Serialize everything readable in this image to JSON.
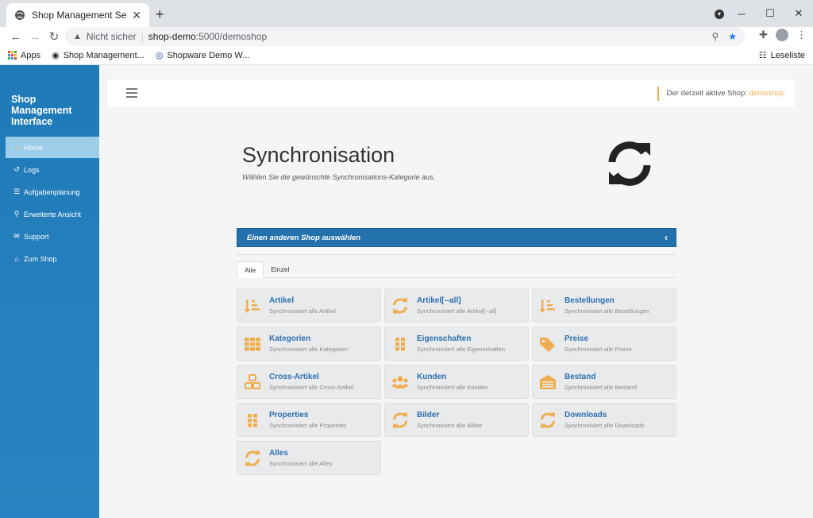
{
  "browser": {
    "tab_title": "Shop Management Service - new",
    "new_tab": "+",
    "window": {
      "minimize": "─",
      "maximize": "☐",
      "close": "✕"
    },
    "address": {
      "security_label": "Nicht sicher",
      "host": "shop-demo",
      "path": ":5000/demoshop"
    },
    "bookmarks": [
      {
        "label": "Apps"
      },
      {
        "label": "Shop Management..."
      },
      {
        "label": "Shopware Demo W..."
      }
    ],
    "reading_list": "Leseliste"
  },
  "sidebar": {
    "brand": [
      "Shop",
      "Management",
      "Interface"
    ],
    "items": [
      {
        "label": "Home",
        "icon": "⌂"
      },
      {
        "label": "Logs",
        "icon": "↺"
      },
      {
        "label": "Aufgabenplanung",
        "icon": "☰"
      },
      {
        "label": "Erweiterte Ansicht",
        "icon": "⚲"
      },
      {
        "label": "Support",
        "icon": "✉"
      },
      {
        "label": "Zum Shop",
        "icon": "⌂"
      }
    ]
  },
  "header": {
    "active_shop_label": "Der derzeit aktive Shop:",
    "active_shop_name": "demoshop"
  },
  "page": {
    "title": "Synchronisation",
    "subtitle": "Wählen Sie die gewünschte Synchronisations-Kategorie aus."
  },
  "shop_panel": {
    "label": "Einen anderen Shop auswählen",
    "chevron": "‹"
  },
  "tabs": [
    {
      "label": "Alle"
    },
    {
      "label": "Einzel"
    }
  ],
  "cards": [
    {
      "title": "Artikel",
      "sub": "Synchronisiert alle Artikel",
      "icon": "sort-icon"
    },
    {
      "title": "Artikel[--all]",
      "sub": "Synchronisiert alle Artikel[--all]",
      "icon": "sync-icon"
    },
    {
      "title": "Bestellungen",
      "sub": "Synchronisiert alle Bestellungen",
      "icon": "sort-icon"
    },
    {
      "title": "Kategorien",
      "sub": "Synchronisiert alle Kategorien",
      "icon": "grid-icon"
    },
    {
      "title": "Eigenschaften",
      "sub": "Synchronisiert alle Eigenschaften",
      "icon": "grid-small-icon"
    },
    {
      "title": "Preise",
      "sub": "Synchronisiert alle Preise",
      "icon": "tags-icon"
    },
    {
      "title": "Cross-Artikel",
      "sub": "Synchronisiert alle Cross-Artikel",
      "icon": "cubes-icon"
    },
    {
      "title": "Kunden",
      "sub": "Synchronisiert alle Kunden",
      "icon": "users-icon"
    },
    {
      "title": "Bestand",
      "sub": "Synchronisiert alle Bestand",
      "icon": "warehouse-icon"
    },
    {
      "title": "Properties",
      "sub": "Synchronisiert alle Properties",
      "icon": "grid-small-icon"
    },
    {
      "title": "Bilder",
      "sub": "Synchronisiert alle Bilder",
      "icon": "sync-icon"
    },
    {
      "title": "Downloads",
      "sub": "Synchronisiert alle Downloads",
      "icon": "sync-icon"
    },
    {
      "title": "Alles",
      "sub": "Synchronisiert alle Alles",
      "icon": "sync-icon"
    }
  ],
  "colors": {
    "accent": "#f0ad4e",
    "primary": "#2372ad",
    "sidebar": "#1f7ab8"
  }
}
